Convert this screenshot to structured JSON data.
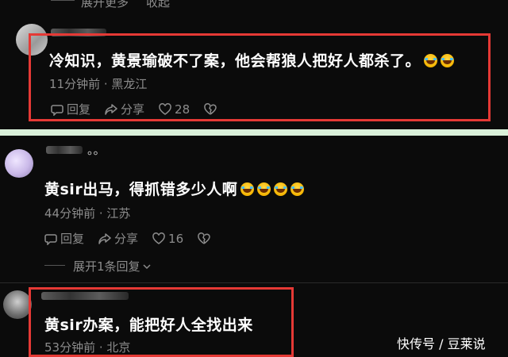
{
  "top": {
    "expand_more": "展开更多",
    "collapse": "收起"
  },
  "comment1": {
    "text": "冷知识，黄景瑜破不了案，他会帮狼人把好人都杀了。",
    "emojis": [
      "laugh-cry-emoji",
      "laugh-cry-emoji"
    ],
    "time": "11分钟前",
    "location": "黑龙江",
    "reply_label": "回复",
    "share_label": "分享",
    "likes": "28"
  },
  "comment2": {
    "name_tail": "。。",
    "text": "黄sir出马，得抓错多少人啊",
    "emojis": [
      "laugh-cry-emoji",
      "laugh-cry-emoji",
      "laugh-cry-emoji",
      "laugh-cry-emoji"
    ],
    "time": "44分钟前",
    "location": "江苏",
    "reply_label": "回复",
    "share_label": "分享",
    "likes": "16",
    "expand_replies": "展开1条回复"
  },
  "comment3": {
    "text": "黄sir办案，能把好人全找出来",
    "time": "53分钟前",
    "location": "北京"
  },
  "watermark": "快传号 / 豆莱说",
  "colors": {
    "highlight_border": "#e53935",
    "background": "#0b0b0b",
    "divider": "#d9f0d9"
  }
}
